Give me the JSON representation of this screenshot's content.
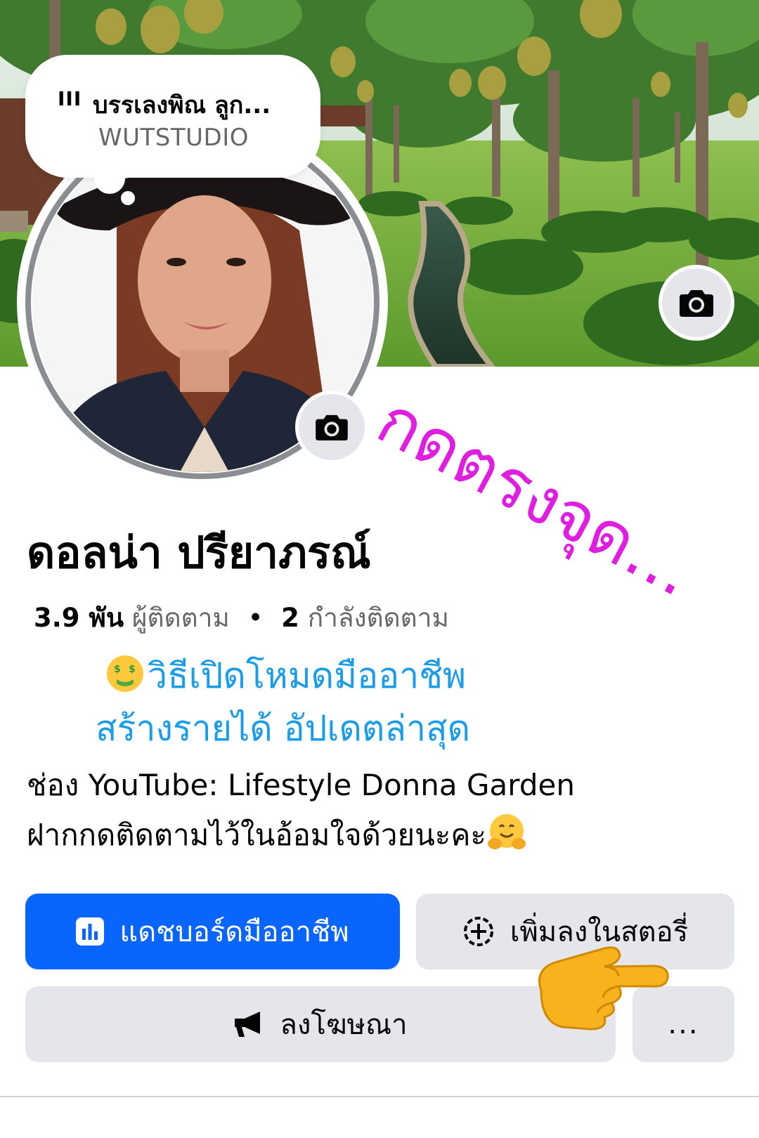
{
  "music_sticker": {
    "bars_icon": "III",
    "song_title": "บรรเลงพิณ ลูก...",
    "artist": "WUTSTUDIO"
  },
  "profile": {
    "name": "ดอลน่า ปรียาภรณ์",
    "followers_count": "3.9 พัน",
    "followers_label": "ผู้ติดตาม",
    "separator": "•",
    "following_count": "2",
    "following_label": "กำลังติดตาม"
  },
  "promo": {
    "line1": "วิธีเปิดโหมดมืออาชีพ",
    "line2": "สร้างรายได้ อัปเดตล่าสุด"
  },
  "bio": {
    "line1": "ช่อง YouTube: Lifestyle Donna Garden",
    "line2": "ฝากกดติดตามไว้ในอ้อมใจด้วยนะคะ"
  },
  "overlay": {
    "handwritten": "กดตรงจุด..."
  },
  "buttons": {
    "dashboard": "แดชบอร์ดมืออาชีพ",
    "add_story": "เพิ่มลงในสตอรี่",
    "advertise": "ลงโฆษณา",
    "more": "..."
  },
  "colors": {
    "primary": "#0866ff",
    "secondary_bg": "#e4e6eb",
    "promo_text": "#1b9ce8",
    "overlay_text": "#e01ee0"
  },
  "icons": [
    "camera-icon",
    "music-bars-icon",
    "dashboard-icon",
    "add-story-icon",
    "megaphone-icon",
    "pointing-hand-emoji",
    "money-mouth-emoji",
    "hugging-emoji"
  ]
}
